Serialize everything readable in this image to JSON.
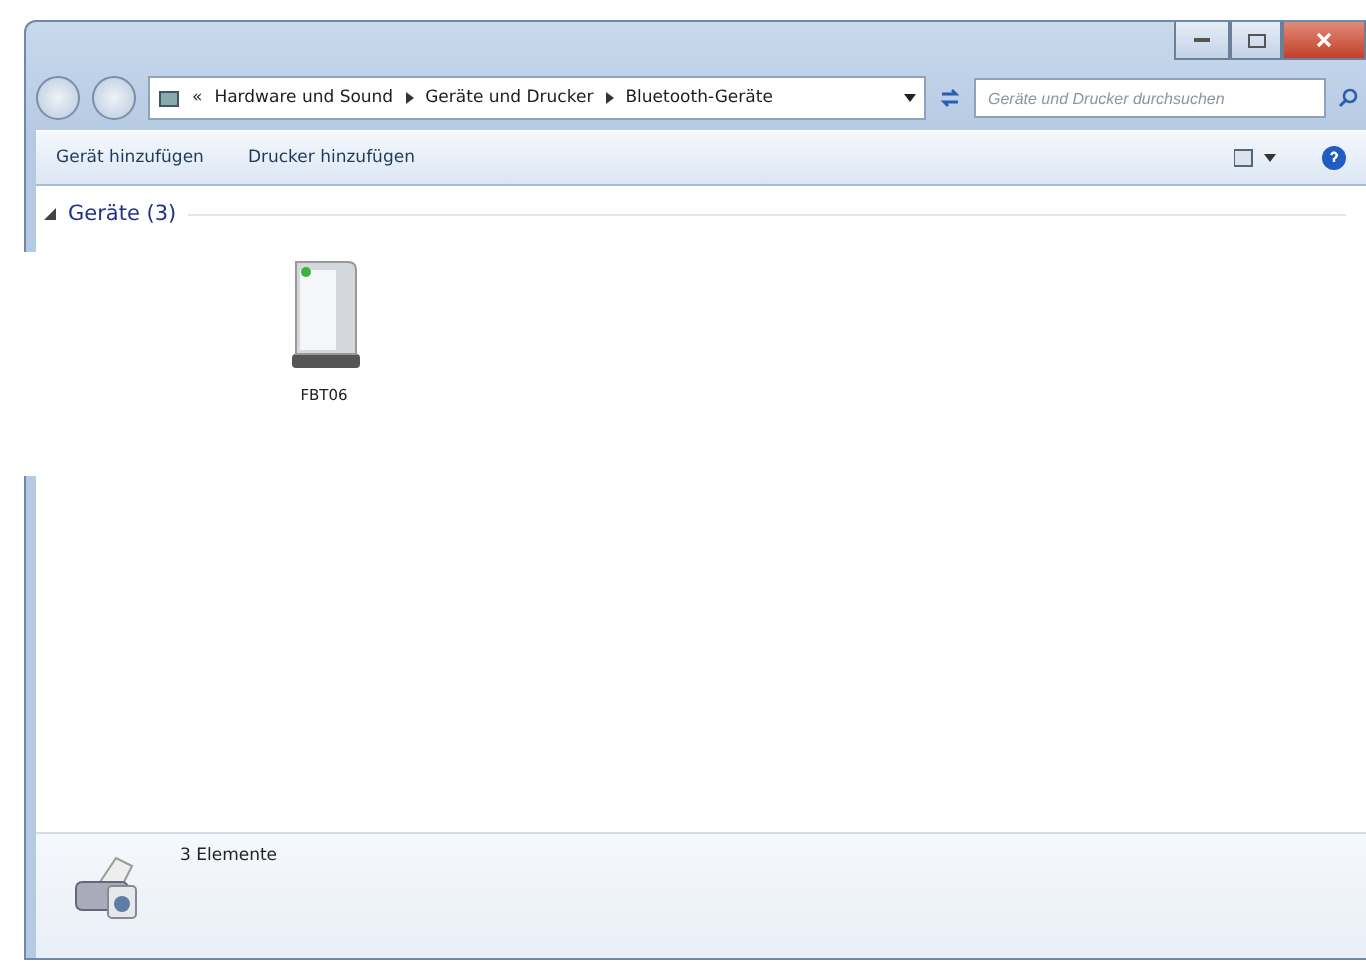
{
  "address_bar": {
    "overflow": "«",
    "crumbs": [
      "Hardware und Sound",
      "Geräte und Drucker",
      "Bluetooth-Geräte"
    ]
  },
  "search": {
    "placeholder": "Geräte und Drucker durchsuchen"
  },
  "toolbar": {
    "buttons": [
      "Gerät hinzufügen",
      "Drucker hinzufügen"
    ]
  },
  "group": {
    "title": "Geräte (3)",
    "expanded": true
  },
  "devices": [
    {
      "name": "FBT06"
    }
  ],
  "details": {
    "text": "3 Elemente"
  }
}
